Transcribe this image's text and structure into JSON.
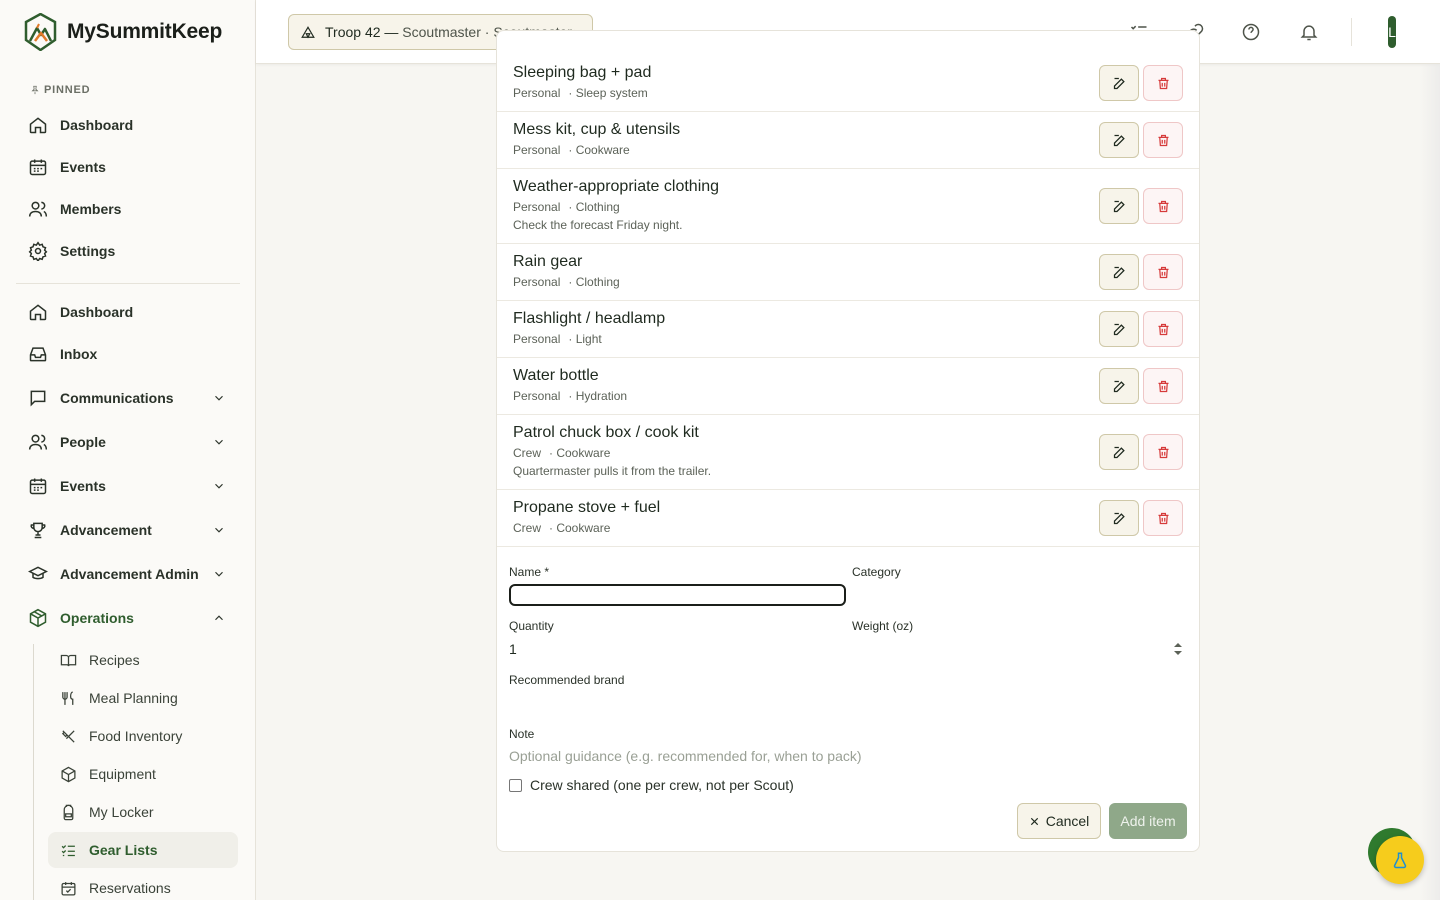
{
  "app": {
    "name": "MySummitKeep"
  },
  "header": {
    "troop_name": "Troop 42 —",
    "troop_role": "Scoutmaster · Scoutmaster",
    "avatar_initial": "L"
  },
  "sidebar": {
    "pinned_label": "PINNED",
    "pinned": [
      {
        "label": "Dashboard",
        "icon": "home-icon"
      },
      {
        "label": "Events",
        "icon": "calendar-icon"
      },
      {
        "label": "Members",
        "icon": "users-icon"
      },
      {
        "label": "Settings",
        "icon": "gear-icon"
      }
    ],
    "main": [
      {
        "label": "Dashboard",
        "icon": "home-icon"
      },
      {
        "label": "Inbox",
        "icon": "inbox-icon"
      },
      {
        "label": "Communications",
        "icon": "chat-icon",
        "expandable": true
      },
      {
        "label": "People",
        "icon": "users-icon",
        "expandable": true
      },
      {
        "label": "Events",
        "icon": "calendar-icon",
        "expandable": true
      },
      {
        "label": "Advancement",
        "icon": "trophy-icon",
        "expandable": true
      },
      {
        "label": "Advancement Admin",
        "icon": "graduation-cap-icon",
        "expandable": true
      },
      {
        "label": "Operations",
        "icon": "box-icon",
        "expandable": true,
        "expanded": true
      }
    ],
    "operations_sub": [
      {
        "label": "Recipes",
        "icon": "book-icon"
      },
      {
        "label": "Meal Planning",
        "icon": "utensils-icon"
      },
      {
        "label": "Food Inventory",
        "icon": "utensils-crossed-icon"
      },
      {
        "label": "Equipment",
        "icon": "package-icon"
      },
      {
        "label": "My Locker",
        "icon": "backpack-icon"
      },
      {
        "label": "Gear Lists",
        "icon": "list-checks-icon",
        "active": true
      },
      {
        "label": "Reservations",
        "icon": "calendar-check-icon"
      }
    ]
  },
  "gear_items": [
    {
      "name": "Sleeping bag + pad",
      "scope": "Personal",
      "category": "· Sleep system",
      "note": ""
    },
    {
      "name": "Mess kit, cup & utensils",
      "scope": "Personal",
      "category": "· Cookware",
      "note": ""
    },
    {
      "name": "Weather-appropriate clothing",
      "scope": "Personal",
      "category": "· Clothing",
      "note": "Check the forecast Friday night."
    },
    {
      "name": "Rain gear",
      "scope": "Personal",
      "category": "· Clothing",
      "note": ""
    },
    {
      "name": "Flashlight / headlamp",
      "scope": "Personal",
      "category": "· Light",
      "note": ""
    },
    {
      "name": "Water bottle",
      "scope": "Personal",
      "category": "· Hydration",
      "note": ""
    },
    {
      "name": "Patrol chuck box / cook kit",
      "scope": "Crew",
      "category": "· Cookware",
      "note": "Quartermaster pulls it from the trailer."
    },
    {
      "name": "Propane stove + fuel",
      "scope": "Crew",
      "category": "· Cookware",
      "note": ""
    }
  ],
  "form": {
    "name_label": "Name *",
    "name_value": "",
    "category_label": "Category",
    "quantity_label": "Quantity",
    "quantity_value": "1",
    "weight_label": "Weight (oz)",
    "brand_label": "Recommended brand",
    "note_label": "Note",
    "note_placeholder": "Optional guidance (e.g. recommended for, when to pack)",
    "crew_shared_label": "Crew shared (one per crew, not per Scout)",
    "crew_shared_checked": false,
    "cancel_label": "Cancel",
    "add_label": "Add item"
  },
  "colors": {
    "brand_green": "#2f5d2e",
    "danger_red": "#d63a3a",
    "fab_yellow": "#f6cc1c"
  }
}
